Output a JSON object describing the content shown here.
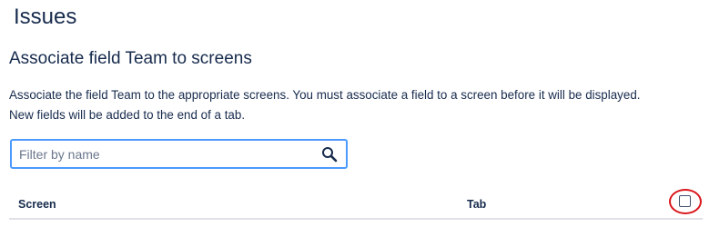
{
  "header": {
    "app_title": "Issues"
  },
  "section": {
    "title": "Associate field Team to screens",
    "description_line1": "Associate the field Team to the appropriate screens. You must associate a field to a screen before it will be displayed.",
    "description_line2": "New fields will be added to the end of a tab."
  },
  "filter": {
    "value": "",
    "placeholder": "Filter by name",
    "icon": "search-icon"
  },
  "table": {
    "columns": [
      "Screen",
      "Tab"
    ],
    "select_all_checked": false
  },
  "colors": {
    "focus_border": "#4c9aff",
    "annotation_circle": "#d9161b",
    "text": "#172b4d"
  }
}
